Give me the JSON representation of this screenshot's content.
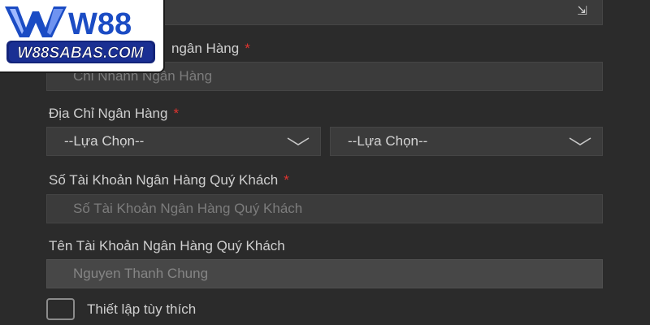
{
  "logo": {
    "brand": "W88",
    "subtitle": "W88SABAS.COM",
    "colors": {
      "blue": "#1b4cc4",
      "navy": "#13247a",
      "white": "#ffffff"
    }
  },
  "top_bar": {
    "icon": "arrow-icon",
    "glyph": "⇲"
  },
  "form": {
    "branch": {
      "label": "Chi Nhánh Ngân Hàng",
      "label_visible": "ngân Hàng",
      "required_mark": "*",
      "placeholder": "Chi Nhánh Ngân Hàng"
    },
    "address": {
      "label": "Địa Chỉ Ngân Hàng",
      "required_mark": "*",
      "select_1": "--Lựa Chọn--",
      "select_2": "--Lựa Chọn--"
    },
    "account_number": {
      "label": "Số Tài Khoản Ngân Hàng Quý Khách",
      "required_mark": "*",
      "placeholder": "Số Tài Khoản Ngân Hàng Quý Khách"
    },
    "account_name": {
      "label": "Tên Tài Khoản Ngân Hàng Quý Khách",
      "value": "Nguyen Thanh Chung"
    },
    "custom_setting": {
      "label": "Thiết lập tùy thích",
      "checked": false
    }
  },
  "colors": {
    "background": "#2b2b2b",
    "field": "#3b3b3b",
    "required": "#e0342f",
    "label_text": "#cfcfcf"
  }
}
